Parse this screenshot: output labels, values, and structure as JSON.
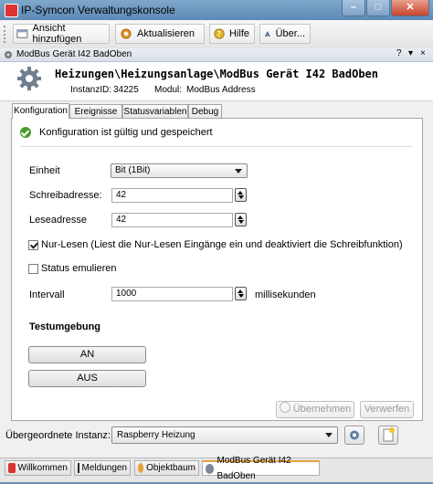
{
  "window": {
    "title": "IP-Symcon Verwaltungskonsole",
    "controls": [
      "–",
      "□",
      "✕"
    ]
  },
  "toolbar": {
    "add_view": "Ansicht hinzufügen",
    "refresh": "Aktualisieren",
    "help": "Hilfe",
    "about": "Über..."
  },
  "doc_tab": {
    "title": "ModBus Gerät I42 BadOben",
    "help": "?",
    "pin": "▾",
    "close": "×"
  },
  "header": {
    "path": "Heizungen\\Heizungsanlage\\ModBus Gerät I42 BadOben",
    "instance_label": "InstanzID:",
    "instance_id": "34225",
    "module_label": "Modul:",
    "module_name": "ModBus Address"
  },
  "tabs": [
    "Konfiguration",
    "Ereignisse",
    "Statusvariablen",
    "Debug"
  ],
  "status_message": "Konfiguration ist gültig und gespeichert",
  "form": {
    "unit_label": "Einheit",
    "unit_value": "Bit (1Bit)",
    "write_label": "Schreibadresse:",
    "write_value": "42",
    "read_label": "Leseadresse",
    "read_value": "42",
    "readonly_label": "Nur-Lesen (Liest die Nur-Lesen Eingänge ein und deaktiviert die Schreibfunktion)",
    "readonly_checked": true,
    "emulate_label": "Status emulieren",
    "emulate_checked": false,
    "interval_label": "Intervall",
    "interval_value": "1000",
    "interval_unit": "millisekunden"
  },
  "test": {
    "heading": "Testumgebung",
    "on_label": "AN",
    "off_label": "AUS"
  },
  "actions": {
    "apply": "Übernehmen",
    "discard": "Verwerfen"
  },
  "parent": {
    "label": "Übergeordnete Instanz:",
    "value": "Raspberry Heizung"
  },
  "bottom_tabs": [
    "Willkommen",
    "Meldungen",
    "Objektbaum",
    "ModBus Gerät I42 BadOben"
  ],
  "colors": {
    "accent": "#5d89b5",
    "ok_green": "#4a9b2e",
    "active_tab_marker": "#e5a33d"
  }
}
